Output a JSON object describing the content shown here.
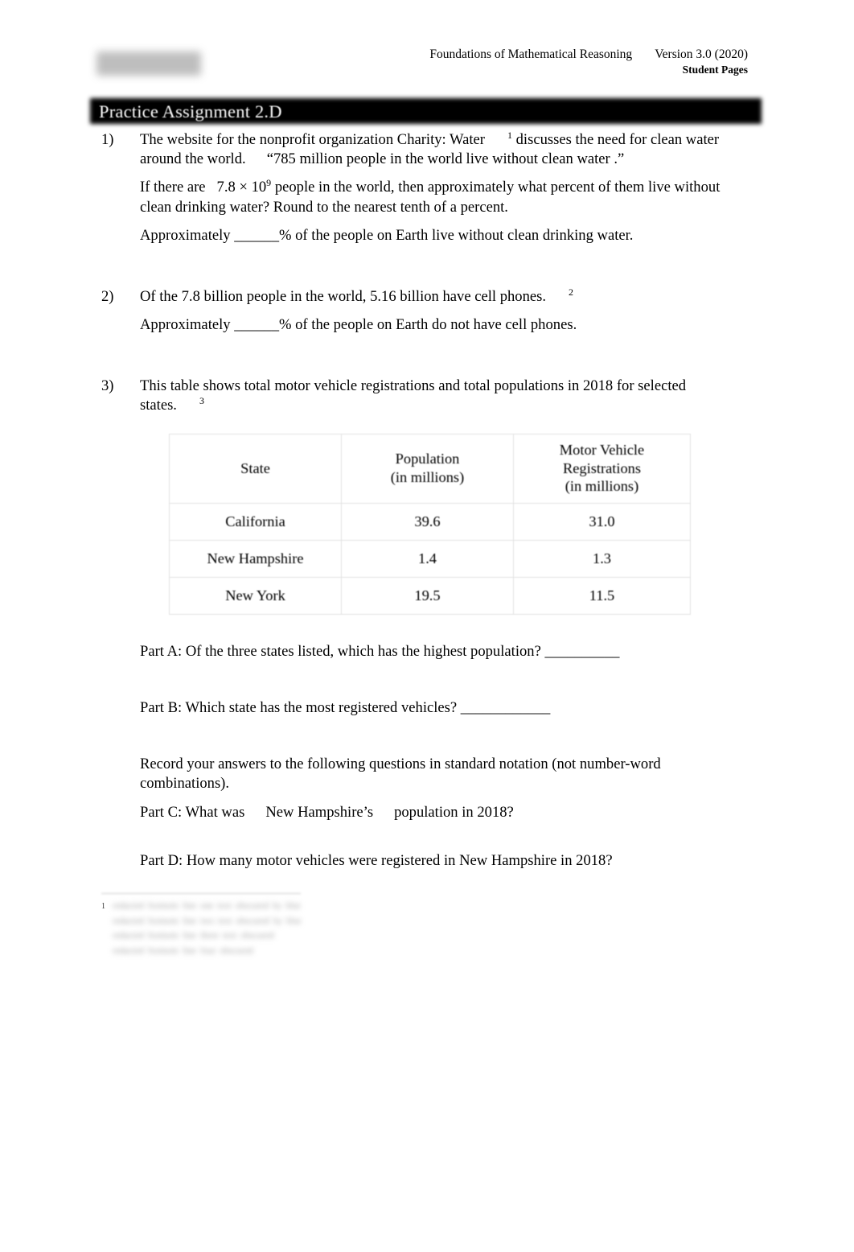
{
  "document": {
    "header": {
      "logo_alt": "institution-logo",
      "course_title": "Foundations of Mathematical Reasoning",
      "version": "Version 3.0 (2020)",
      "subtitle": "Student Pages"
    },
    "banner_title": "Practice Assignment 2.D"
  },
  "questions": [
    {
      "number": "1)",
      "paragraphs": [
        {
          "parts": [
            {
              "text": "The website for the nonprofit organization Charity: Water"
            },
            {
              "sup": "1"
            },
            {
              "text": "discusses the need for clean water around the world."
            },
            {
              "gap": "md"
            },
            {
              "text": "“785 million people in the world live without clean water .”"
            }
          ]
        },
        {
          "parts": [
            {
              "text": "If there are"
            },
            {
              "gap": "sm"
            },
            {
              "text": "7.8 × 10"
            },
            {
              "sup": "9"
            },
            {
              "text": "people in the world, then approximately what percent of them live without clean drinking water? Round to the nearest tenth of a percent."
            }
          ]
        },
        {
          "parts": [
            {
              "text": "Approximately ______% of the people on Earth live without clean drinking water."
            }
          ]
        }
      ]
    },
    {
      "number": "2)",
      "paragraphs": [
        {
          "parts": [
            {
              "text": "Of the 7.8 billion people in the world, 5.16 billion have cell phones."
            },
            {
              "sup": "2"
            }
          ]
        },
        {
          "parts": [
            {
              "text": "Approximately ______% of the people on Earth do not have cell phones."
            }
          ]
        }
      ]
    },
    {
      "number": "3)",
      "paragraphs": [
        {
          "parts": [
            {
              "text": "This table shows total motor vehicle registrations and total populations in 2018 for selected states."
            },
            {
              "sup": "3"
            }
          ]
        }
      ]
    }
  ],
  "q1_line1_a": "The website for the nonprofit organization Charity: Water",
  "q1_sup": "1",
  "q1_line1_b": "discusses the need for",
  "q1_line2_a": "clean water around the world.",
  "q1_line2_b": "“785 million people in the world live without clean",
  "q1_line3": "water .”",
  "q1_p2_a": "If there are",
  "q1_p2_b": "7.8 × 10",
  "q1_p2_sup": "9",
  "q1_p2_c": "people in the world, then approximately what percent of them live without clean drinking water? Round to the nearest tenth of a percent.",
  "q1_p3": "Approximately ______% of the people on Earth live without clean drinking water.",
  "q1_num": "1)",
  "q2_num": "2)",
  "q2_p1": "Of the 7.8 billion people in the world, 5.16 billion have cell phones.",
  "q2_sup": "2",
  "q2_p2": "Approximately ______% of the people on Earth do not have cell phones.",
  "q3_num": "3)",
  "q3_p1": "This table shows total motor vehicle registrations and total populations in 2018 for selected states.",
  "q3_sup": "3",
  "table": {
    "columns": [
      {
        "label_line1": "State",
        "label_line2": ""
      },
      {
        "label_line1": "Population",
        "label_line2": "(in millions)"
      },
      {
        "label_line1": "Motor Vehicle",
        "label_line2": "Registrations",
        "label_line3": "(in millions)"
      }
    ],
    "header": {
      "state": "State",
      "population_l1": "Population",
      "population_l2": "(in millions)",
      "mvr_l1": "Motor Vehicle",
      "mvr_l2": "Registrations",
      "mvr_l3": "(in millions)"
    },
    "rows": [
      {
        "state": "California",
        "population": "39.6",
        "registrations": "31.0"
      },
      {
        "state": "New Hampshire",
        "population": "1.4",
        "registrations": "1.3"
      },
      {
        "state": "New York",
        "population": "19.5",
        "registrations": "11.5"
      }
    ]
  },
  "parts": {
    "a": "Part A: Of the three states listed, which has the highest population? __________",
    "b": "Part B: Which state has the most registered vehicles? ____________",
    "instruction": "Record your answers to the following questions in standard notation (not number-word combinations).",
    "c_a": "Part C: What was",
    "c_b": "New Hampshire’s",
    "c_c": "population in 2018?",
    "d": "Part D: How many motor vehicles were registered in New Hampshire in 2018?"
  },
  "footnote": {
    "marker": "1",
    "lines": [
      "redacted footnote line one text obscured by blur",
      "redacted footnote line two text obscured by blur",
      "redacted footnote line three text obscured",
      "redacted footnote line four obscured"
    ]
  }
}
